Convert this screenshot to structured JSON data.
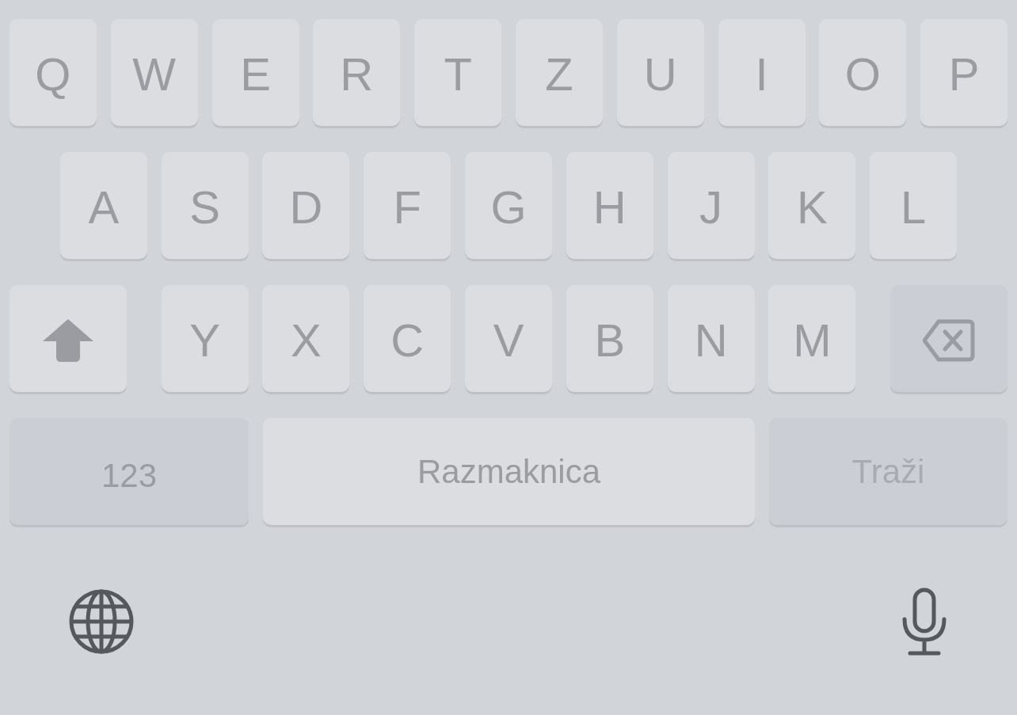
{
  "rows": [
    {
      "keys": [
        {
          "kind": "letter",
          "label": "Q"
        },
        {
          "kind": "letter",
          "label": "W"
        },
        {
          "kind": "letter",
          "label": "E"
        },
        {
          "kind": "letter",
          "label": "R"
        },
        {
          "kind": "letter",
          "label": "T"
        },
        {
          "kind": "letter",
          "label": "Z"
        },
        {
          "kind": "letter",
          "label": "U"
        },
        {
          "kind": "letter",
          "label": "I"
        },
        {
          "kind": "letter",
          "label": "O"
        },
        {
          "kind": "letter",
          "label": "P"
        }
      ]
    },
    {
      "keys": [
        {
          "kind": "letter",
          "label": "A"
        },
        {
          "kind": "letter",
          "label": "S"
        },
        {
          "kind": "letter",
          "label": "D"
        },
        {
          "kind": "letter",
          "label": "F"
        },
        {
          "kind": "letter",
          "label": "G"
        },
        {
          "kind": "letter",
          "label": "H"
        },
        {
          "kind": "letter",
          "label": "J"
        },
        {
          "kind": "letter",
          "label": "K"
        },
        {
          "kind": "letter",
          "label": "L"
        }
      ]
    },
    {
      "keys": [
        {
          "kind": "shift"
        },
        {
          "kind": "letter",
          "label": "Y"
        },
        {
          "kind": "letter",
          "label": "X"
        },
        {
          "kind": "letter",
          "label": "C"
        },
        {
          "kind": "letter",
          "label": "V"
        },
        {
          "kind": "letter",
          "label": "B"
        },
        {
          "kind": "letter",
          "label": "N"
        },
        {
          "kind": "letter",
          "label": "M"
        },
        {
          "kind": "delete"
        }
      ]
    },
    {
      "keys": [
        {
          "kind": "numbers",
          "label": "123"
        },
        {
          "kind": "space",
          "label": "Razmaknica"
        },
        {
          "kind": "return",
          "label": "Traži",
          "disabled": true
        }
      ]
    }
  ]
}
